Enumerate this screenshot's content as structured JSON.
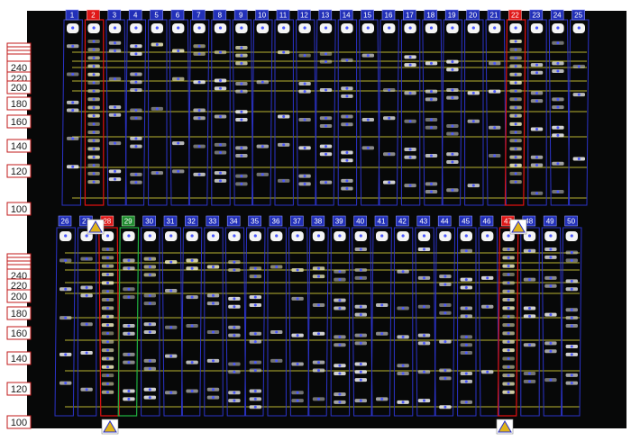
{
  "top_panel": {
    "lane_labels": [
      "1",
      "2",
      "3",
      "4",
      "5",
      "6",
      "7",
      "8",
      "9",
      "10",
      "11",
      "12",
      "13",
      "14",
      "15",
      "16",
      "17",
      "18",
      "19",
      "20",
      "21",
      "22",
      "23",
      "24",
      "25"
    ],
    "highlighted_red": [
      "2",
      "22"
    ],
    "marker_labels": [
      "240",
      "220",
      "200",
      "180",
      "160",
      "140",
      "120",
      "100"
    ]
  },
  "bottom_panel": {
    "lane_labels": [
      "26",
      "27",
      "28",
      "29",
      "30",
      "31",
      "32",
      "33",
      "34",
      "35",
      "36",
      "37",
      "38",
      "39",
      "40",
      "41",
      "42",
      "43",
      "44",
      "45",
      "46",
      "47",
      "48",
      "49",
      "50"
    ],
    "highlighted_red": [
      "28",
      "47"
    ],
    "highlighted_green": [
      "29"
    ],
    "marker_labels": [
      "240",
      "220",
      "200",
      "180",
      "160",
      "140",
      "120",
      "100"
    ]
  },
  "colors": {
    "lane_outline": "#2b33c9",
    "lane_tag": "#2230b8",
    "highlight_red": "#e01010",
    "highlight_green": "#20b040",
    "guide_line": "#d9d23a",
    "background": "#070808"
  }
}
